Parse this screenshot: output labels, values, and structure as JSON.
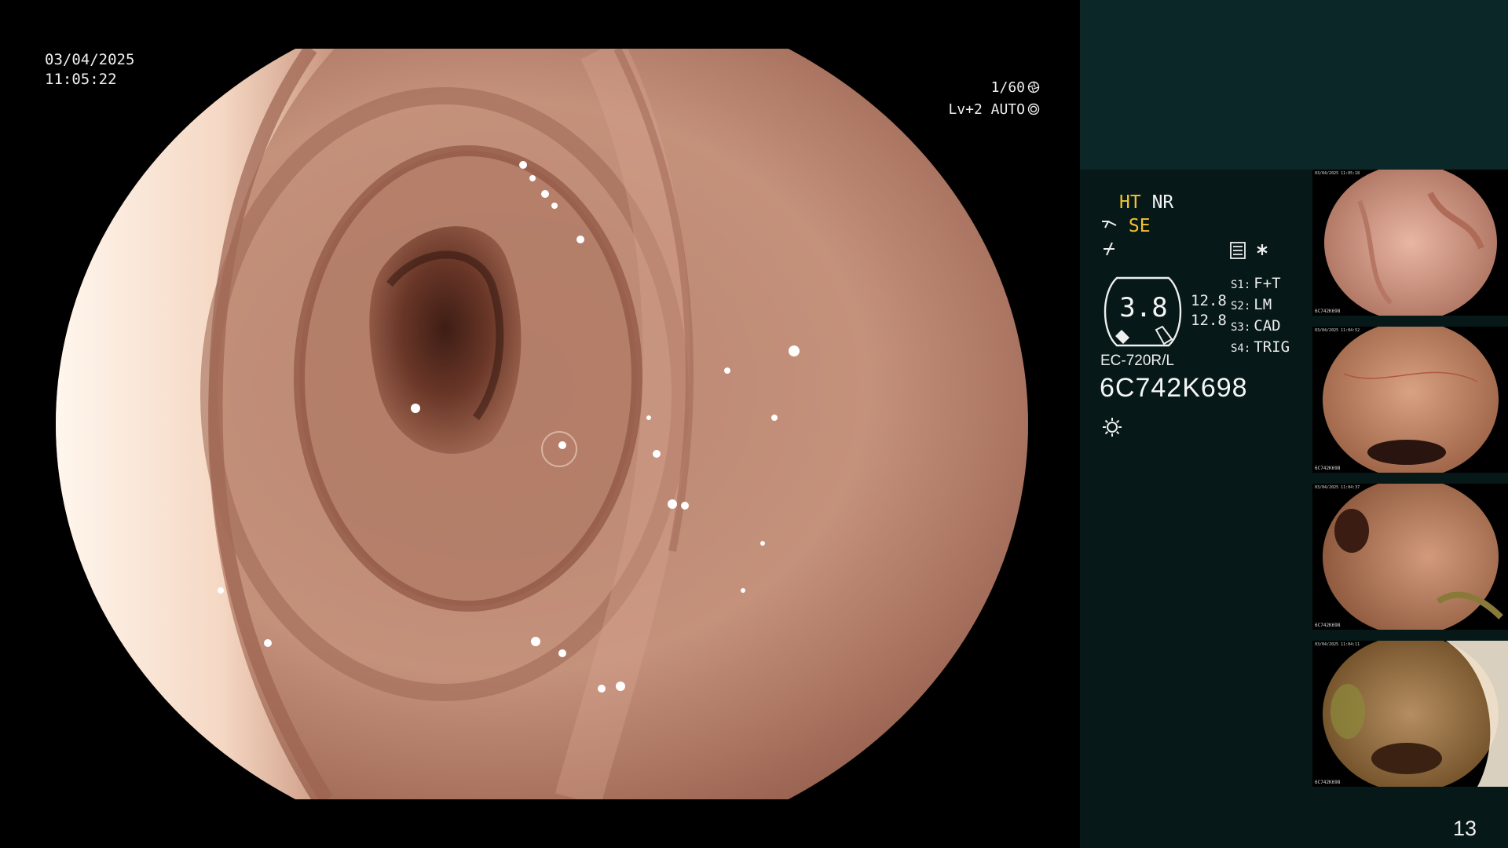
{
  "overlay": {
    "date": "03/04/2025",
    "time": "11:05:22",
    "shutter": "1/60",
    "level": "Lv+2 AUTO"
  },
  "panel": {
    "mode_ht": "HT",
    "mode_nr": "NR",
    "mode_se": "SE",
    "gauge_value": "3.8",
    "mag_top": "12.8",
    "mag_bottom": "12.8",
    "slots": [
      {
        "key": "S1:",
        "value": "F+T"
      },
      {
        "key": "S2:",
        "value": "LM"
      },
      {
        "key": "S3:",
        "value": "CAD"
      },
      {
        "key": "S4:",
        "value": "TRIG"
      }
    ],
    "scope_model": "EC-720R/L",
    "serial": "6C742K698",
    "page_number": "13"
  },
  "thumbnails": [
    {
      "info": "03/04/2025 11:05:18",
      "id": "6C742K698",
      "index": "12"
    },
    {
      "info": "03/04/2025 11:04:52",
      "id": "6C742K698",
      "index": "11"
    },
    {
      "info": "03/04/2025 11:04:37",
      "id": "6C742K698",
      "index": "10"
    },
    {
      "info": "03/04/2025 11:04:11",
      "id": "6C742K698",
      "index": "9"
    }
  ],
  "colors": {
    "panel_top": "#0c2727",
    "panel_main": "#061818",
    "accent_yellow": "#f4c230",
    "text": "#f2f2f2"
  },
  "icons": [
    "shutter-icon",
    "auto-iris-icon",
    "structure-icon",
    "color-tone-icon",
    "menu-icon",
    "asterisk-icon",
    "light-icon"
  ]
}
